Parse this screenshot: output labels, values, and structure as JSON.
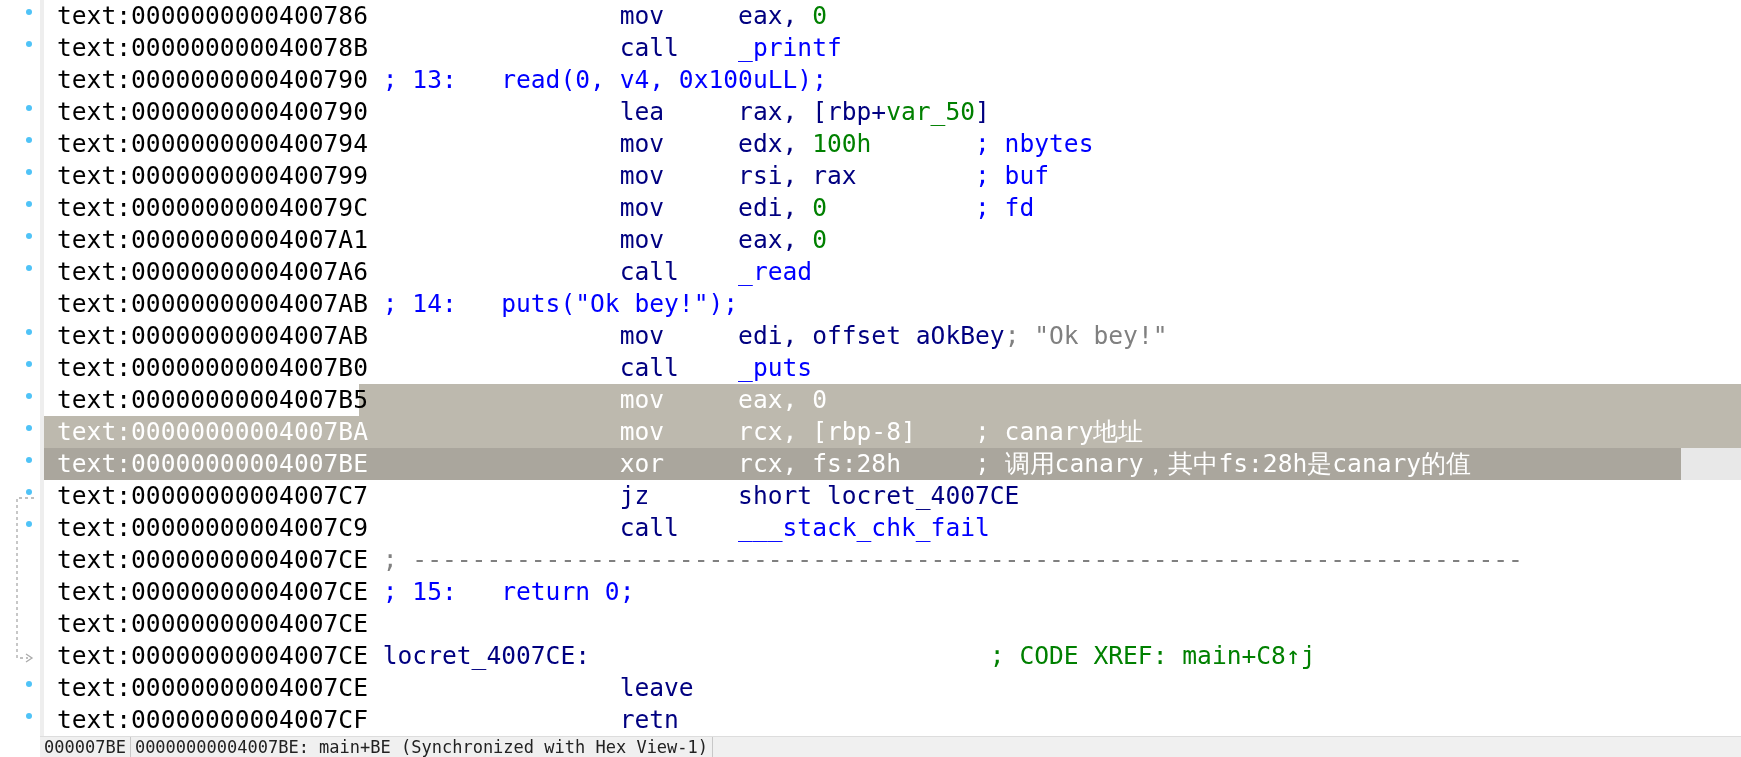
{
  "listing": {
    "rows": [
      {
        "address": "text:0000000000400786",
        "kind": "insn",
        "mnemonic": "mov",
        "operands": [
          {
            "text": "eax, ",
            "kind": "reg"
          },
          {
            "text": "0",
            "kind": "num"
          }
        ],
        "selected": false,
        "current": false
      },
      {
        "address": "text:000000000040078B",
        "kind": "insn",
        "mnemonic": "call",
        "operands": [
          {
            "text": "_printf",
            "kind": "name"
          }
        ],
        "selected": false,
        "current": false
      },
      {
        "address": "text:0000000000400790",
        "kind": "source",
        "line": "; 13:",
        "code": "read(0, v4, 0x100uLL);",
        "selected": false,
        "current": false
      },
      {
        "address": "text:0000000000400790",
        "kind": "insn",
        "mnemonic": "lea",
        "operands": [
          {
            "text": "rax, [rbp+",
            "kind": "reg"
          },
          {
            "text": "var_50",
            "kind": "var"
          },
          {
            "text": "]",
            "kind": "reg"
          }
        ],
        "selected": false,
        "current": false
      },
      {
        "address": "text:0000000000400794",
        "kind": "insn",
        "mnemonic": "mov",
        "operands": [
          {
            "text": "edx, ",
            "kind": "reg"
          },
          {
            "text": "100h",
            "kind": "num"
          }
        ],
        "comment": {
          "text": "; nbytes",
          "kind": "auto"
        },
        "selected": false,
        "current": false
      },
      {
        "address": "text:0000000000400799",
        "kind": "insn",
        "mnemonic": "mov",
        "operands": [
          {
            "text": "rsi, rax",
            "kind": "reg"
          }
        ],
        "comment": {
          "text": "; buf",
          "kind": "auto"
        },
        "selected": false,
        "current": false
      },
      {
        "address": "text:000000000040079C",
        "kind": "insn",
        "mnemonic": "mov",
        "operands": [
          {
            "text": "edi, ",
            "kind": "reg"
          },
          {
            "text": "0",
            "kind": "num"
          }
        ],
        "comment": {
          "text": "; fd",
          "kind": "auto"
        },
        "selected": false,
        "current": false
      },
      {
        "address": "text:00000000004007A1",
        "kind": "insn",
        "mnemonic": "mov",
        "operands": [
          {
            "text": "eax, ",
            "kind": "reg"
          },
          {
            "text": "0",
            "kind": "num"
          }
        ],
        "selected": false,
        "current": false
      },
      {
        "address": "text:00000000004007A6",
        "kind": "insn",
        "mnemonic": "call",
        "operands": [
          {
            "text": "_read",
            "kind": "name"
          }
        ],
        "selected": false,
        "current": false
      },
      {
        "address": "text:00000000004007AB",
        "kind": "source",
        "line": "; 14:",
        "code": "puts(\"Ok bey!\");",
        "selected": false,
        "current": false
      },
      {
        "address": "text:00000000004007AB",
        "kind": "insn",
        "mnemonic": "mov",
        "operands": [
          {
            "text": "edi, offset aOkBey",
            "kind": "reg"
          }
        ],
        "comment": {
          "text": "; \"Ok bey!\"",
          "kind": "string"
        },
        "selected": false,
        "current": false
      },
      {
        "address": "text:00000000004007B0",
        "kind": "insn",
        "mnemonic": "call",
        "operands": [
          {
            "text": "_puts",
            "kind": "name"
          }
        ],
        "selected": false,
        "current": false
      },
      {
        "address": "text:00000000004007B5",
        "kind": "insn",
        "mnemonic": "mov",
        "operands": [
          {
            "text": "eax, ",
            "kind": "reg"
          },
          {
            "text": "0",
            "kind": "num"
          }
        ],
        "selected": true,
        "current": false
      },
      {
        "address": "text:00000000004007BA",
        "kind": "insn",
        "mnemonic": "mov",
        "operands": [
          {
            "text": "rcx, [rbp-8]",
            "kind": "reg"
          }
        ],
        "comment": {
          "text": "; canary地址",
          "kind": "user"
        },
        "selected": true,
        "current": false
      },
      {
        "address": "text:00000000004007BE",
        "kind": "insn",
        "mnemonic": "xor",
        "operands": [
          {
            "text": "rcx, fs:28h",
            "kind": "reg"
          }
        ],
        "comment": {
          "text": "; 调用canary，其中fs:28h是canary的值",
          "kind": "user"
        },
        "selected": true,
        "current": true
      },
      {
        "address": "text:00000000004007C7",
        "kind": "insn",
        "mnemonic": "jz",
        "operands": [
          {
            "text": "short locret_4007CE",
            "kind": "reg"
          }
        ],
        "selected": false,
        "current": false
      },
      {
        "address": "text:00000000004007C9",
        "kind": "insn",
        "mnemonic": "call",
        "operands": [
          {
            "text": "___stack_chk_fail",
            "kind": "name"
          }
        ],
        "selected": false,
        "current": false
      },
      {
        "address": "text:00000000004007CE",
        "kind": "separator",
        "text": "; ---------------------------------------------------------------------------",
        "selected": false,
        "current": false
      },
      {
        "address": "text:00000000004007CE",
        "kind": "source",
        "line": "; 15:",
        "code": "return 0;",
        "selected": false,
        "current": false
      },
      {
        "address": "text:00000000004007CE",
        "kind": "blank",
        "selected": false,
        "current": false
      },
      {
        "address": "text:00000000004007CE",
        "kind": "label",
        "label": "locret_4007CE:",
        "comment": {
          "text": "; CODE XREF: main+C8↑j",
          "kind": "xref"
        },
        "selected": false,
        "current": false
      },
      {
        "address": "text:00000000004007CE",
        "kind": "insn",
        "mnemonic": "leave",
        "operands": [],
        "selected": false,
        "current": false
      },
      {
        "address": "text:00000000004007CF",
        "kind": "insn",
        "mnemonic": "retn",
        "operands": [],
        "selected": false,
        "current": false
      }
    ]
  },
  "status_bar": {
    "offset": "000007BE",
    "location": "00000000004007BE: main+BE (Synchronized with Hex View-1)"
  }
}
